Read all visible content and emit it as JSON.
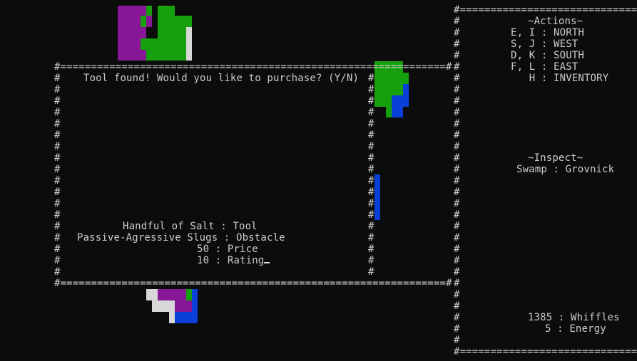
{
  "colors": {
    "background": "#0c0c0c",
    "text": "#cccccc",
    "tile_purple": "#881798",
    "tile_green": "#16a00e",
    "tile_blue": "#0a40d8",
    "tile_white": "#d8d8d8"
  },
  "dialog": {
    "prompt": "Tool found! Would you like to purchase? (Y/N)",
    "item_name": "Handful of Salt : Tool",
    "item_obstacle": "Passive-Agressive Slugs : Obstacle",
    "item_price": "50 : Price",
    "item_rating": "10 : Rating"
  },
  "sidebar": {
    "actions_title": "~Actions~",
    "actions": [
      "E, I : NORTH",
      "S, J : WEST",
      "D, K : SOUTH",
      "F, L : EAST",
      "   H : INVENTORY"
    ],
    "inspect_title": "~Inspect~",
    "inspect_value": "Swamp : Grovnick",
    "whiffles": "1385 : Whiffles",
    "energy": "5 : Energy"
  }
}
